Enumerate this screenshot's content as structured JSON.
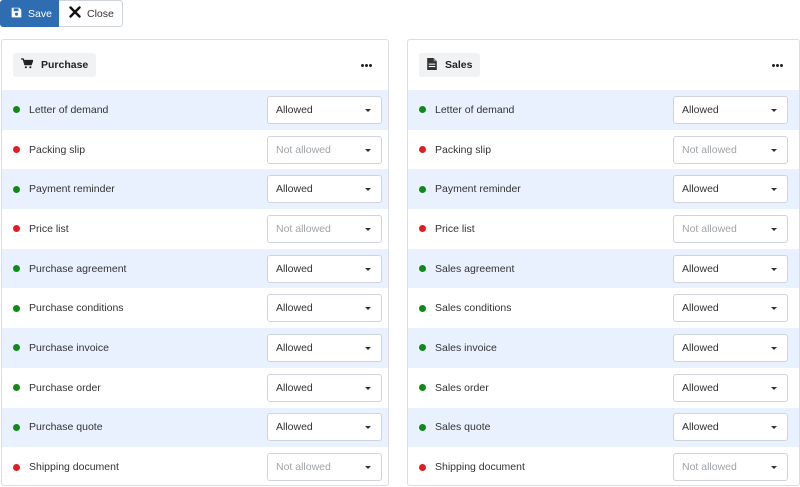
{
  "toolbar": {
    "save_label": "Save",
    "close_label": "Close",
    "save_icon": "floppy-disk-icon",
    "close_icon": "close-icon"
  },
  "colors": {
    "allowed_dot": "#0e8a16",
    "not_allowed_dot": "#e31b23",
    "row_highlight": "#e8f1fd",
    "primary": "#2f6db3"
  },
  "panels": [
    {
      "title": "Purchase",
      "icon": "shopping-cart-icon",
      "menu_icon": "more-horizontal-icon",
      "rows": [
        {
          "label": "Letter of demand",
          "status": "allowed",
          "value": "Allowed"
        },
        {
          "label": "Packing slip",
          "status": "not_allowed",
          "value": "Not allowed"
        },
        {
          "label": "Payment reminder",
          "status": "allowed",
          "value": "Allowed"
        },
        {
          "label": "Price list",
          "status": "not_allowed",
          "value": "Not allowed"
        },
        {
          "label": "Purchase agreement",
          "status": "allowed",
          "value": "Allowed"
        },
        {
          "label": "Purchase conditions",
          "status": "allowed",
          "value": "Allowed"
        },
        {
          "label": "Purchase invoice",
          "status": "allowed",
          "value": "Allowed"
        },
        {
          "label": "Purchase order",
          "status": "allowed",
          "value": "Allowed"
        },
        {
          "label": "Purchase quote",
          "status": "allowed",
          "value": "Allowed"
        },
        {
          "label": "Shipping document",
          "status": "not_allowed",
          "value": "Not allowed"
        }
      ]
    },
    {
      "title": "Sales",
      "icon": "document-icon",
      "menu_icon": "more-horizontal-icon",
      "rows": [
        {
          "label": "Letter of demand",
          "status": "allowed",
          "value": "Allowed"
        },
        {
          "label": "Packing slip",
          "status": "not_allowed",
          "value": "Not allowed"
        },
        {
          "label": "Payment reminder",
          "status": "allowed",
          "value": "Allowed"
        },
        {
          "label": "Price list",
          "status": "not_allowed",
          "value": "Not allowed"
        },
        {
          "label": "Sales agreement",
          "status": "allowed",
          "value": "Allowed"
        },
        {
          "label": "Sales conditions",
          "status": "allowed",
          "value": "Allowed"
        },
        {
          "label": "Sales invoice",
          "status": "allowed",
          "value": "Allowed"
        },
        {
          "label": "Sales order",
          "status": "allowed",
          "value": "Allowed"
        },
        {
          "label": "Sales quote",
          "status": "allowed",
          "value": "Allowed"
        },
        {
          "label": "Shipping document",
          "status": "not_allowed",
          "value": "Not allowed"
        }
      ]
    }
  ]
}
